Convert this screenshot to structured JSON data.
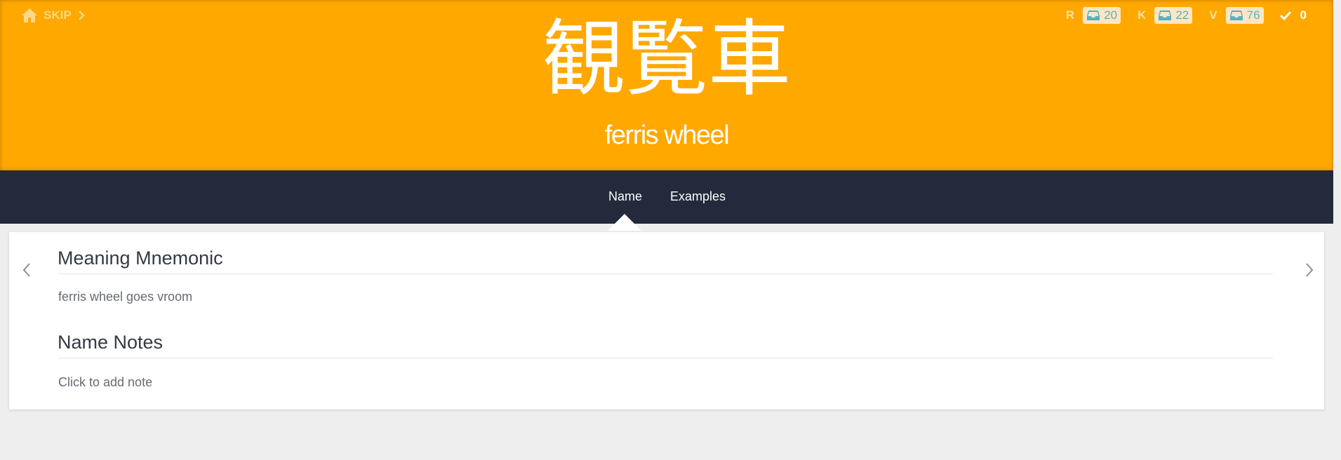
{
  "header": {
    "home_icon": "home-icon",
    "skip_label": "SKIP",
    "skip_icon": "chevron-right-icon",
    "subject": "観覧車",
    "meaning": "ferris wheel",
    "background_color": "#ffa800",
    "stats": [
      {
        "letter": "R",
        "icon": "inbox-icon",
        "count": "20"
      },
      {
        "letter": "K",
        "icon": "inbox-icon",
        "count": "22"
      },
      {
        "letter": "V",
        "icon": "inbox-icon",
        "count": "76"
      }
    ],
    "done": {
      "icon": "check-icon",
      "count": "0"
    }
  },
  "tabs": [
    {
      "label": "Name",
      "active": true
    },
    {
      "label": "Examples",
      "active": false
    }
  ],
  "content": {
    "sections": [
      {
        "title": "Meaning Mnemonic",
        "body": "ferris wheel goes vroom"
      },
      {
        "title": "Name Notes",
        "body": "Click to add note"
      }
    ],
    "prev_icon": "chevron-left-icon",
    "next_icon": "chevron-right-icon"
  },
  "colors": {
    "tabbar": "#242a3b",
    "badge_text": "#58b0c4",
    "page_background": "#eeeeee"
  }
}
